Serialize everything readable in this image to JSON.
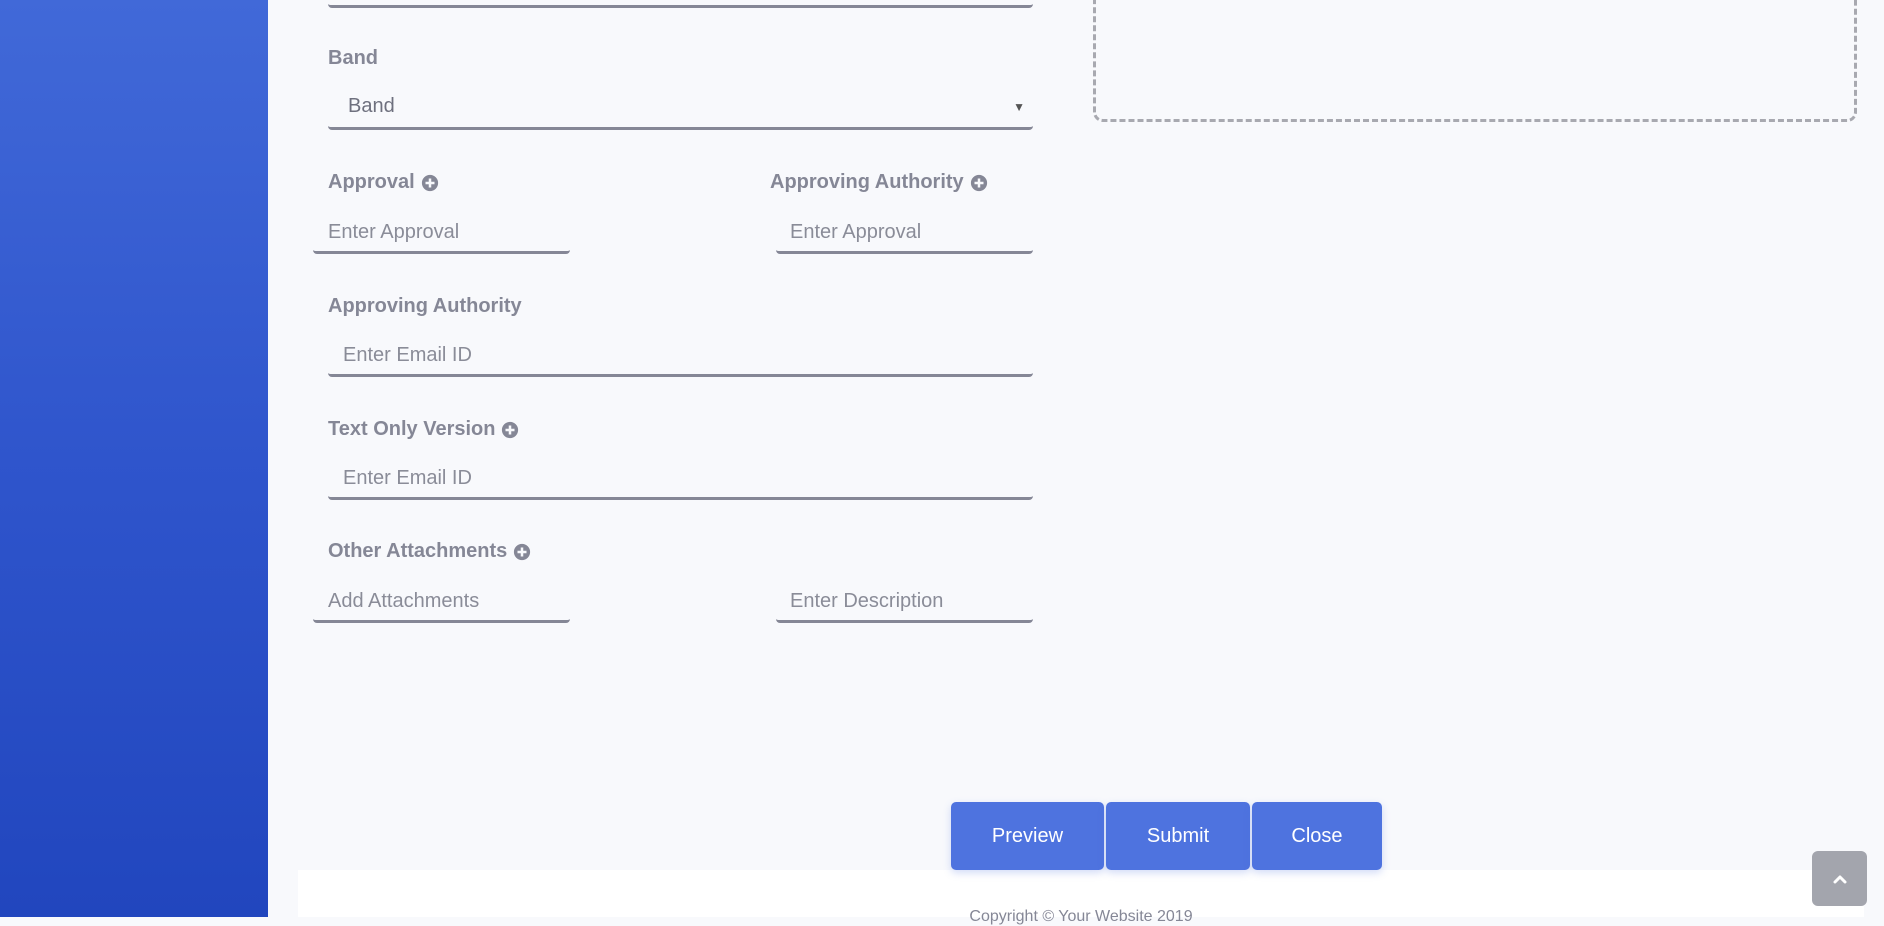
{
  "form": {
    "band": {
      "label": "Band",
      "selected": "Band"
    },
    "approval": {
      "label": "Approval",
      "placeholder": "Enter Approval"
    },
    "approving_authority_inline": {
      "label": "Approving Authority",
      "placeholder": "Enter Approval"
    },
    "approving_authority": {
      "label": "Approving Authority",
      "placeholder": "Enter Email ID"
    },
    "text_only_version": {
      "label": "Text Only Version",
      "placeholder": "Enter Email ID"
    },
    "other_attachments": {
      "label": "Other Attachments",
      "attachments_placeholder": "Add Attachments",
      "description_placeholder": "Enter Description"
    }
  },
  "actions": {
    "preview_label": "Preview",
    "submit_label": "Submit",
    "close_label": "Close"
  },
  "footer": {
    "copyright": "Copyright © Your Website 2019"
  },
  "colors": {
    "accent": "#4e73df",
    "sidebar_top": "#4169d8",
    "sidebar_bottom": "#2146be",
    "label": "#858796"
  },
  "icons": {
    "plus": "plus-circle-icon",
    "caret": "caret-down-icon",
    "scroll_top": "chevron-up-icon"
  }
}
